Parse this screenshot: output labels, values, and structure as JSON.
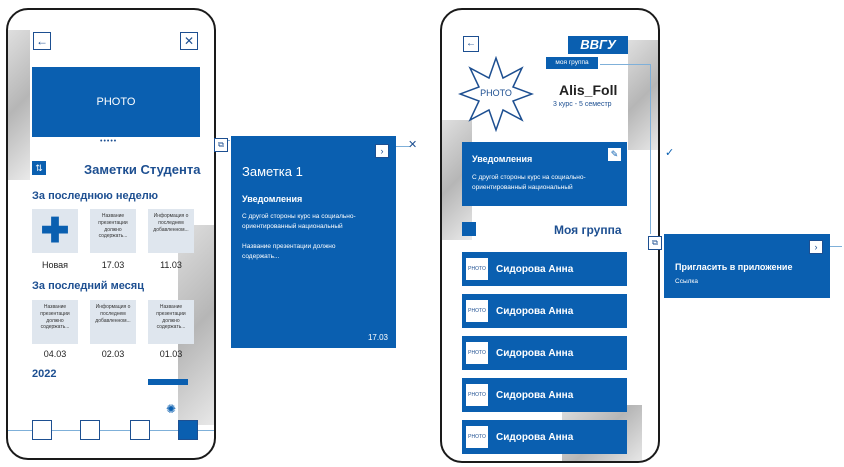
{
  "screen1": {
    "photo_label": "PHOTO",
    "dots": "•••••",
    "title": "Заметки Студента",
    "section_week": "За последнюю неделю",
    "week_cards": [
      {
        "card_text": "",
        "label": "Новая"
      },
      {
        "card_text": "Название презентации должно содержать...",
        "label": "17.03"
      },
      {
        "card_text": "Информация о последнем добавленном...",
        "label": "11.03"
      }
    ],
    "section_month": "За последний месяц",
    "month_cards": [
      {
        "card_text": "Название презентации должно содержать...",
        "label": "04.03"
      },
      {
        "card_text": "Информация о последнем добавленном...",
        "label": "02.03"
      },
      {
        "card_text": "Название презентации должно содержать...",
        "label": "01.03"
      }
    ],
    "section_year": "2022"
  },
  "note_panel": {
    "title": "Заметка 1",
    "heading": "Уведомления",
    "body": "С другой стороны курс на социально-ориентированный национальный",
    "body2": "Название презентации должно содержать...",
    "date": "17.03"
  },
  "screen2": {
    "logo": "ВВГУ",
    "group_tag": "моя группа",
    "photo_label": "PHOTO",
    "username": "Alis_Foll",
    "course": "3 курс - 5 семестр",
    "notif_title": "Уведомления",
    "notif_body": "С другой стороны курс на социально-ориентированный национальный",
    "group_title": "Моя группа",
    "members": [
      {
        "photo": "PHOTO",
        "name": "Сидорова Анна"
      },
      {
        "photo": "PHOTO",
        "name": "Сидорова Анна"
      },
      {
        "photo": "PHOTO",
        "name": "Сидорова Анна"
      },
      {
        "photo": "PHOTO",
        "name": "Сидорова Анна"
      },
      {
        "photo": "PHOTO",
        "name": "Сидорова Анна"
      }
    ]
  },
  "invite_panel": {
    "title": "Пригласить в приложение",
    "subtitle": "Ссылка"
  },
  "colors": {
    "accent": "#0a5fb0",
    "text": "#1d4f91",
    "card": "#dfe6ee"
  }
}
